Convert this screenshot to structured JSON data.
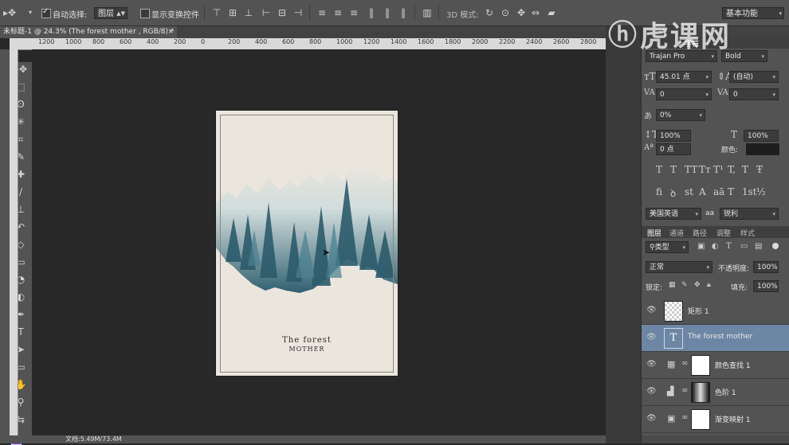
{
  "options_bar": {
    "auto_select_label": "自动选择:",
    "auto_select_value": "图层",
    "show_transform_label": "显示变换控件",
    "mode_3d_label": "3D 模式:",
    "workspace": "基本功能"
  },
  "document_tab": {
    "title": "未标题-1 @ 24.3% (The forest  mother , RGB/8) *",
    "close": "×"
  },
  "ruler": {
    "ticks": [
      "1200",
      "1000",
      "800",
      "600",
      "400",
      "200",
      "0",
      "200",
      "400",
      "600",
      "800",
      "1000",
      "1200",
      "1400",
      "1600",
      "1800",
      "2000",
      "2200",
      "2400",
      "2600",
      "2800",
      "3000",
      "3200"
    ]
  },
  "poster": {
    "line1": "The forest",
    "line2": "MOTHER"
  },
  "status_bar": {
    "doc_info": "文档:5.49M/73.4M"
  },
  "character_panel": {
    "tab_label": "字符",
    "font_family": "Trajan Pro",
    "font_style": "Bold",
    "font_size": "45.01 点",
    "leading": "(自动)",
    "kerning": "0",
    "tracking": "0",
    "tsume": "0%",
    "vertical_scale": "100%",
    "horizontal_scale": "100%",
    "baseline_shift": "0 点",
    "color_label": "颜色:",
    "language": "美国英语",
    "antialias_label": "aa",
    "antialias": "锐利",
    "style_glyphs": [
      "T",
      "T",
      "TT",
      "Tт",
      "T¹",
      "T,",
      "T",
      "Ŧ"
    ],
    "opentype_glyphs": [
      "fi",
      "ꝺ",
      "st",
      "A",
      "aā",
      "T",
      "1st",
      "½"
    ]
  },
  "layers_panel": {
    "tabs": [
      "图层",
      "通道",
      "路径",
      "调整",
      "样式"
    ],
    "filter_kind": "类型",
    "blend_mode": "正常",
    "opacity_label": "不透明度:",
    "opacity": "100%",
    "lock_label": "锁定:",
    "fill_label": "填充:",
    "fill": "100%",
    "layers": [
      {
        "name": "矩形 1",
        "type": "shape",
        "selected": false
      },
      {
        "name": "The forest  mother",
        "type": "text",
        "selected": true
      },
      {
        "name": "颜色查找 1",
        "type": "adjustment",
        "selected": false
      },
      {
        "name": "色阶 1",
        "type": "adjustment",
        "selected": false
      },
      {
        "name": "渐变映射 1",
        "type": "adjustment",
        "selected": false
      }
    ]
  },
  "watermark": "虎课网",
  "colors": {
    "selection": "#6d86a5",
    "poster_bg": "#ebe6dd",
    "forest": "#3f7486",
    "foreground_swatch": "#8a2be2"
  }
}
